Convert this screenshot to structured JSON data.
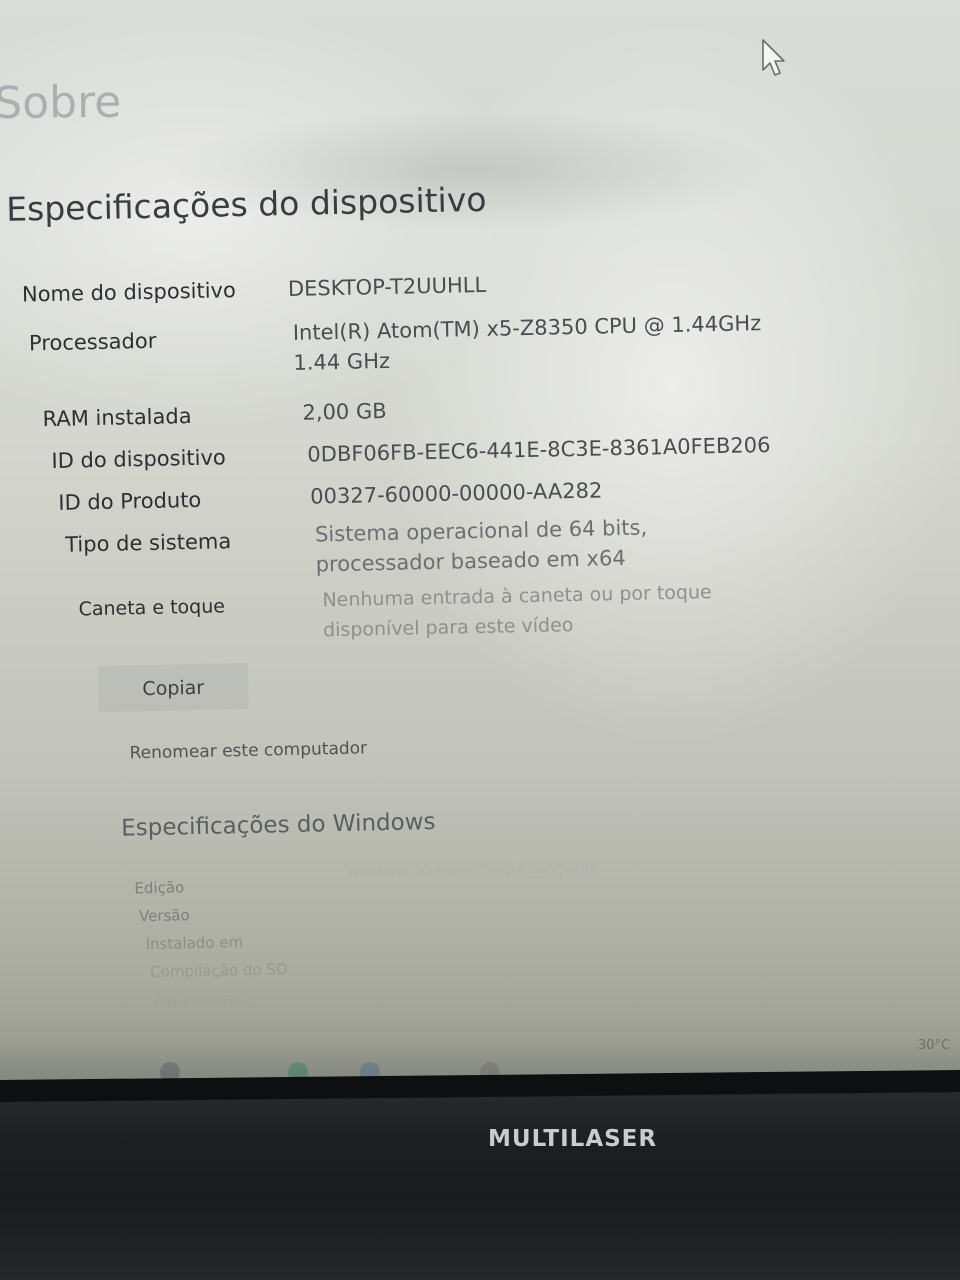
{
  "page": {
    "title": "Sobre"
  },
  "device_specs": {
    "section_title": "Especificações do dispositivo",
    "rows": [
      {
        "label": "Nome do dispositivo",
        "value": "DESKTOP-T2UUHLL"
      },
      {
        "label": "Processador",
        "value": "Intel(R) Atom(TM) x5-Z8350  CPU @ 1.44GHz   1.44 GHz"
      },
      {
        "label": "RAM instalada",
        "value": "2,00 GB"
      },
      {
        "label": "ID do dispositivo",
        "value": "0DBF06FB-EEC6-441E-8C3E-8361A0FEB206"
      },
      {
        "label": "ID do Produto",
        "value": "00327-60000-00000-AA282"
      },
      {
        "label": "Tipo de sistema",
        "value": "Sistema operacional de 64 bits, processador baseado em x64"
      },
      {
        "label": "Caneta e toque",
        "value": "Nenhuma entrada à caneta ou por toque disponível para este vídeo"
      }
    ],
    "copy_button": "Copiar",
    "rename_link": "Renomear este computador"
  },
  "windows_specs": {
    "section_title": "Especificações do Windows",
    "labels": [
      "Edição",
      "Versão",
      "Instalado em",
      "Compilação do SO",
      "Experiência"
    ],
    "edition_value": "Windows 10 Home Single Language"
  },
  "taskbar": {
    "temperature": "30°C"
  },
  "hardware": {
    "brand": "MULTILASER"
  },
  "icons": {
    "cursor": "mouse-pointer-icon"
  },
  "colors": {
    "screen_bg": "#d4d6cf",
    "bezel": "#1d1f22",
    "text": "#2d2f31"
  }
}
